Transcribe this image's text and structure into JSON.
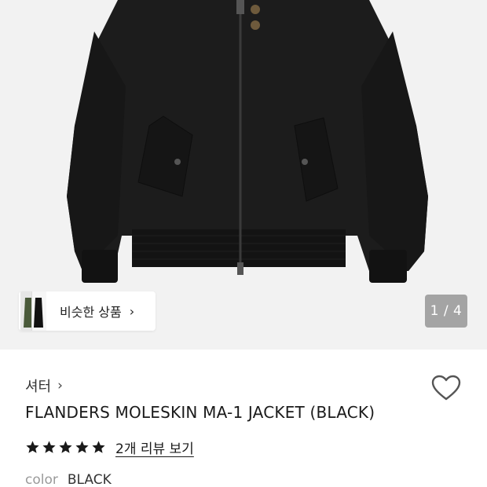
{
  "gallery": {
    "similar_label": "비슷한 상품",
    "similar_chevron": "›",
    "pager_text": "1 / 4"
  },
  "product": {
    "brand": "셔터",
    "brand_chevron": "›",
    "title": "FLANDERS MOLESKIN MA-1 JACKET (BLACK)",
    "rating": 5,
    "rating_max": 5,
    "review_link": "2개 리뷰 보기",
    "color_key": "color",
    "color_value": "BLACK"
  },
  "icons": {
    "wish": "heart-outline-icon",
    "star": "star-icon",
    "brand_chevron": "chevron-right-icon",
    "similar_chevron": "chevron-right-icon"
  },
  "colors": {
    "image_bg": "#f2f2f2",
    "jacket": "#1b1b1b",
    "pager_bg": "rgba(0,0,0,0.32)",
    "star": "#1a1a1a"
  }
}
